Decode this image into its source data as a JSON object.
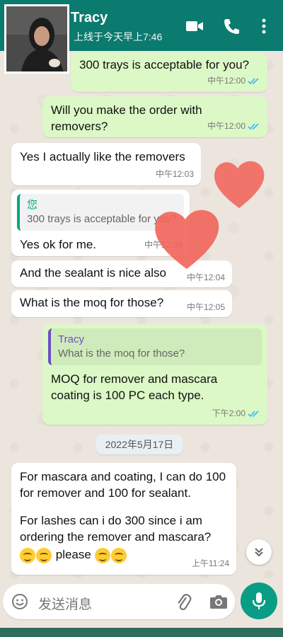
{
  "header": {
    "contact_name": "Tracy",
    "status": "上线于今天早上7:46",
    "icons": [
      "video-call-icon",
      "phone-call-icon",
      "more-options-icon"
    ]
  },
  "messages": [
    {
      "dir": "out",
      "text": "300 trays is acceptable for you?",
      "time": "中午12:00",
      "read": true
    },
    {
      "dir": "out",
      "text": "Will you make the order with removers?",
      "time": "中午12:00",
      "read": true
    },
    {
      "dir": "in",
      "text": "Yes I actually like the removers",
      "time": "中午12:03"
    },
    {
      "dir": "in",
      "quote_author": "您",
      "quote_text": "300 trays is acceptable for you?",
      "text": "Yes ok for me.",
      "time": "中午12:04"
    },
    {
      "dir": "in",
      "text": "And the sealant is nice also",
      "time": "中午12:04"
    },
    {
      "dir": "in",
      "text": "What is the moq for those?",
      "time": "中午12:05"
    },
    {
      "dir": "out",
      "quote_author": "Tracy",
      "quote_text": "What is the moq for those?",
      "text": "MOQ for remover and mascara coating is 100 PC each type.",
      "time": "下午2:00",
      "read": true
    },
    {
      "dir": "in",
      "text_lines": [
        "For mascara and coating, I can do 100 for remover and 100 for sealant.",
        "For lashes can i do 300 since i am ordering the remover and mascara?"
      ],
      "emoji_text": "please",
      "emoji": "smiling-face-emoji",
      "time": "上午11:24"
    }
  ],
  "date_separator": "2022年5月17日",
  "composer": {
    "placeholder": "发送消息",
    "icons": [
      "emoji-icon",
      "attach-icon",
      "camera-icon",
      "microphone-icon"
    ]
  },
  "colors": {
    "header": "#0b7a6f",
    "outgoing_bubble": "#dcf8c6",
    "incoming_bubble": "#ffffff",
    "read_ticks": "#34b7f1",
    "mic_button": "#0a9d85"
  }
}
